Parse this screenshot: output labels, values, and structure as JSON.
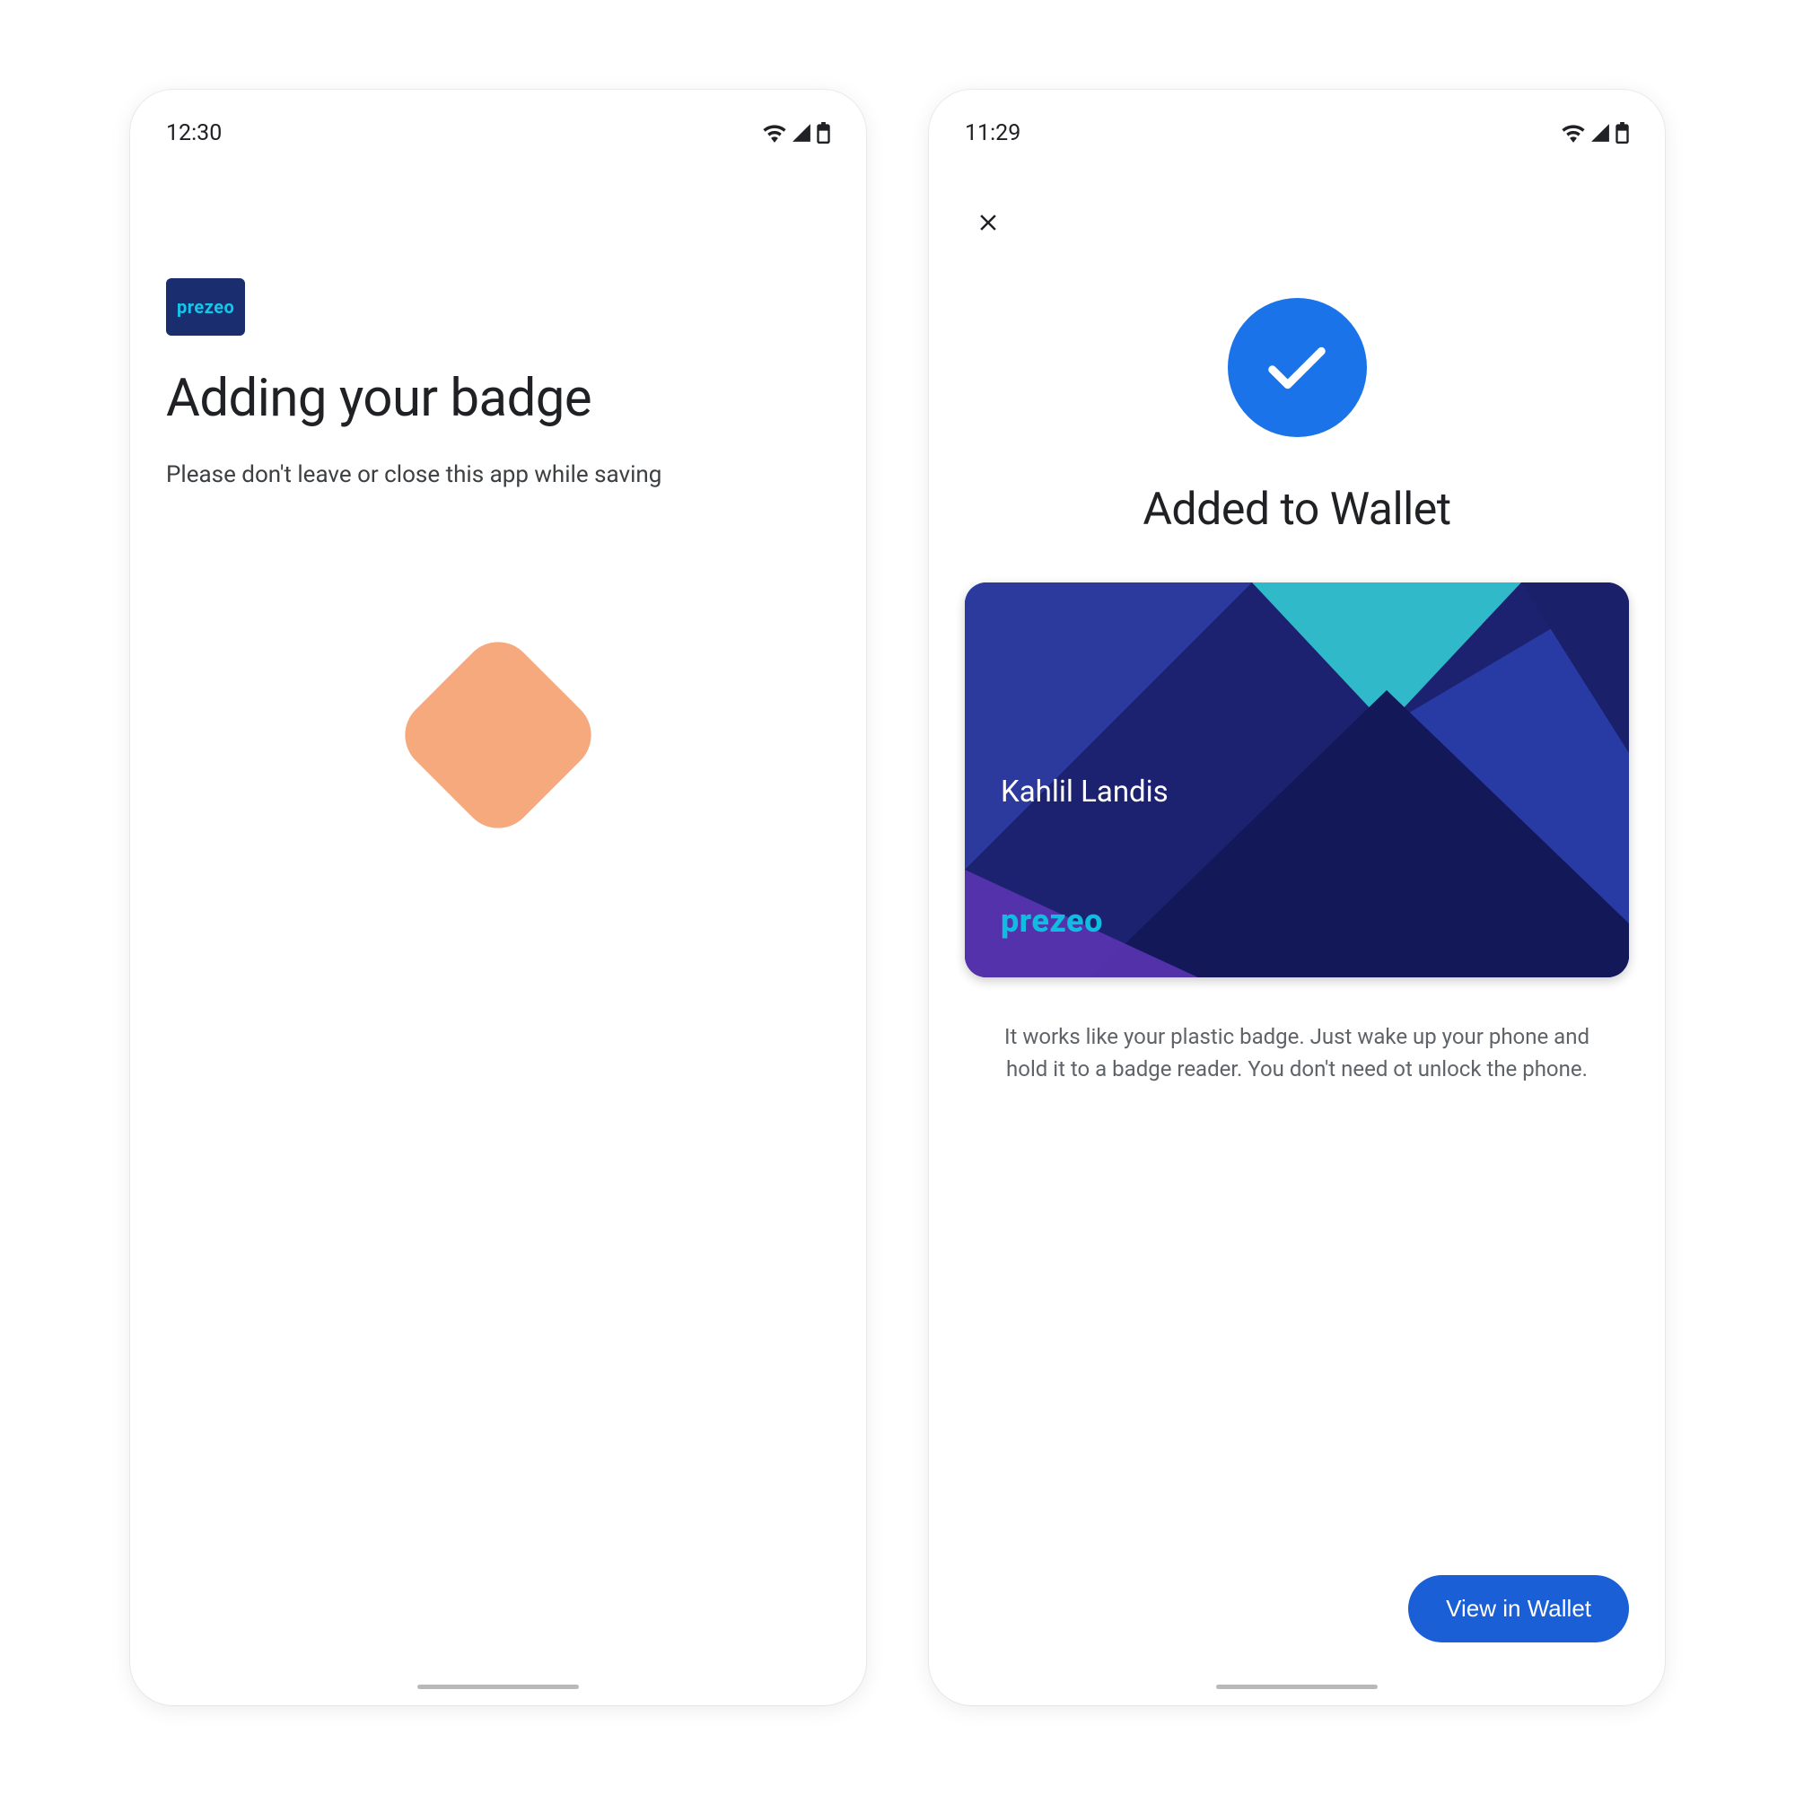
{
  "screen1": {
    "status": {
      "time": "12:30"
    },
    "brand": "prezeo",
    "title": "Adding your badge",
    "subtitle": "Please don't leave or close this app while saving"
  },
  "screen2": {
    "status": {
      "time": "11:29"
    },
    "title": "Added to Wallet",
    "card": {
      "holder_name": "Kahlil Landis",
      "brand": "prezeo"
    },
    "description": "It works like your plastic badge. Just wake up your phone and hold it to a badge reader. You don't need ot unlock the phone.",
    "cta_label": "View in Wallet"
  },
  "colors": {
    "accent": "#1a73e8",
    "brand_bg": "#1a2e6f",
    "brand_text": "#14c7ea",
    "spinner": "#f6a97d"
  }
}
